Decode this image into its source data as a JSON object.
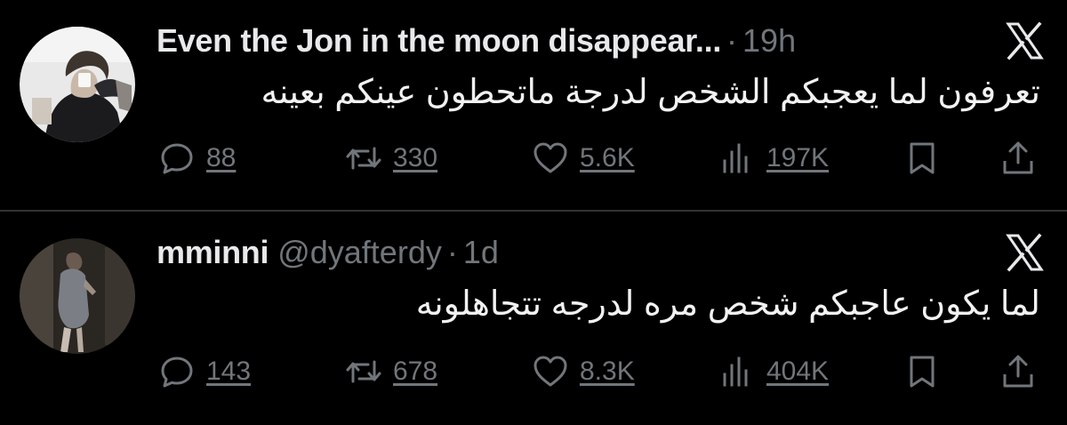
{
  "tweets": [
    {
      "display_name": "Even the Jon in the moon disappear...",
      "handle": "",
      "separator": "·",
      "time": "19h",
      "text": "تعرفون لما يعجبكم الشخص لدرجة ماتحطون عينكم بعينه",
      "stats": {
        "replies": "88",
        "retweets": "330",
        "likes": "5.6K",
        "views": "197K"
      }
    },
    {
      "display_name": "mminni",
      "handle": "@dyafterdy",
      "separator": "·",
      "time": "1d",
      "text": "لما يكون عاجبكم شخص مره لدرجه تتجاهلونه",
      "stats": {
        "replies": "143",
        "retweets": "678",
        "likes": "8.3K",
        "views": "404K"
      }
    }
  ],
  "icons": {
    "logo": "x-logo-icon",
    "reply": "reply-bubble-icon",
    "retweet": "retweet-arrows-icon",
    "like": "heart-icon",
    "views": "bar-chart-views-icon",
    "bookmark": "bookmark-icon",
    "share": "share-upload-icon"
  },
  "colors": {
    "background": "#000000",
    "primary_text": "#e7e9ea",
    "secondary_text": "#71767b",
    "divider": "#2f3336"
  }
}
